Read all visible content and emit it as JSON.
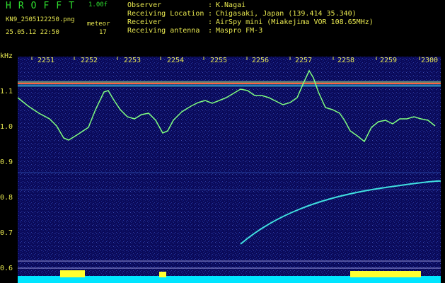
{
  "header": {
    "program": "HROFFT",
    "version": "1.00f",
    "filename": "KN9_2505122250.png",
    "datetime": "25.05.12 22:50",
    "meteor_label": "meteor",
    "meteor_count": "17"
  },
  "info": [
    {
      "label": "Observer",
      "value": "K.Nagai"
    },
    {
      "label": "Receiving Location",
      "value": "Chigasaki, Japan (139.414 35.340)"
    },
    {
      "label": "Receiver",
      "value": "AirSpy mini (Miakejima VOR 108.65MHz)"
    },
    {
      "label": "Receiving antenna",
      "value": "Maspro FM-3"
    }
  ],
  "separator": ":",
  "axis": {
    "unit": "kHz",
    "time_ticks": [
      "2251",
      "2252",
      "2253",
      "2254",
      "2255",
      "2256",
      "2257",
      "2258",
      "2259",
      "2300"
    ],
    "freq_ticks": [
      "1.1",
      "1.0",
      "0.9",
      "0.8",
      "0.7",
      "0.6"
    ]
  },
  "colors": {
    "text": "#e8e850",
    "title": "#2fe02f",
    "background": "#0a0a5a",
    "carrier": "#ff6040",
    "signal": "#80ff80",
    "baseline": "#00e5ff",
    "burst": "#ffff30"
  }
}
